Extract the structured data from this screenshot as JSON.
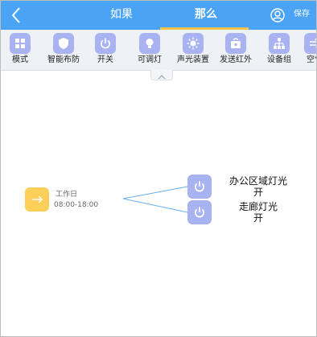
{
  "header": {
    "tab_if": "如果",
    "tab_then": "那么",
    "save_label": "保存",
    "back_icon": "chevron-left-icon",
    "user_icon": "user-circle-icon",
    "bg_color": "#4aa3f5",
    "underline_color": "#f4c34a"
  },
  "toolbar": {
    "items": [
      {
        "label": "模式",
        "icon": "grid-icon"
      },
      {
        "label": "智能布防",
        "icon": "shield-icon"
      },
      {
        "label": "开关",
        "icon": "power-icon"
      },
      {
        "label": "可调灯",
        "icon": "bulb-icon"
      },
      {
        "label": "声光装置",
        "icon": "alarm-icon"
      },
      {
        "label": "发送红外",
        "icon": "infrared-icon"
      },
      {
        "label": "设备组",
        "icon": "network-icon"
      },
      {
        "label": "空气",
        "icon": "air-icon"
      }
    ],
    "tile_color": "#a9b3f2",
    "collapse_icon": "chevron-up-icon"
  },
  "flow": {
    "trigger": {
      "name": "工作日",
      "time": "08:00-18:00",
      "icon": "arrow-right-icon",
      "color": "#fbcf58"
    },
    "actions": [
      {
        "line1": "办公区域灯光",
        "line2": "开",
        "icon": "power-icon"
      },
      {
        "line1": "走廊灯光",
        "line2": "开",
        "icon": "power-icon"
      }
    ],
    "connector_color": "#6aaef0"
  }
}
